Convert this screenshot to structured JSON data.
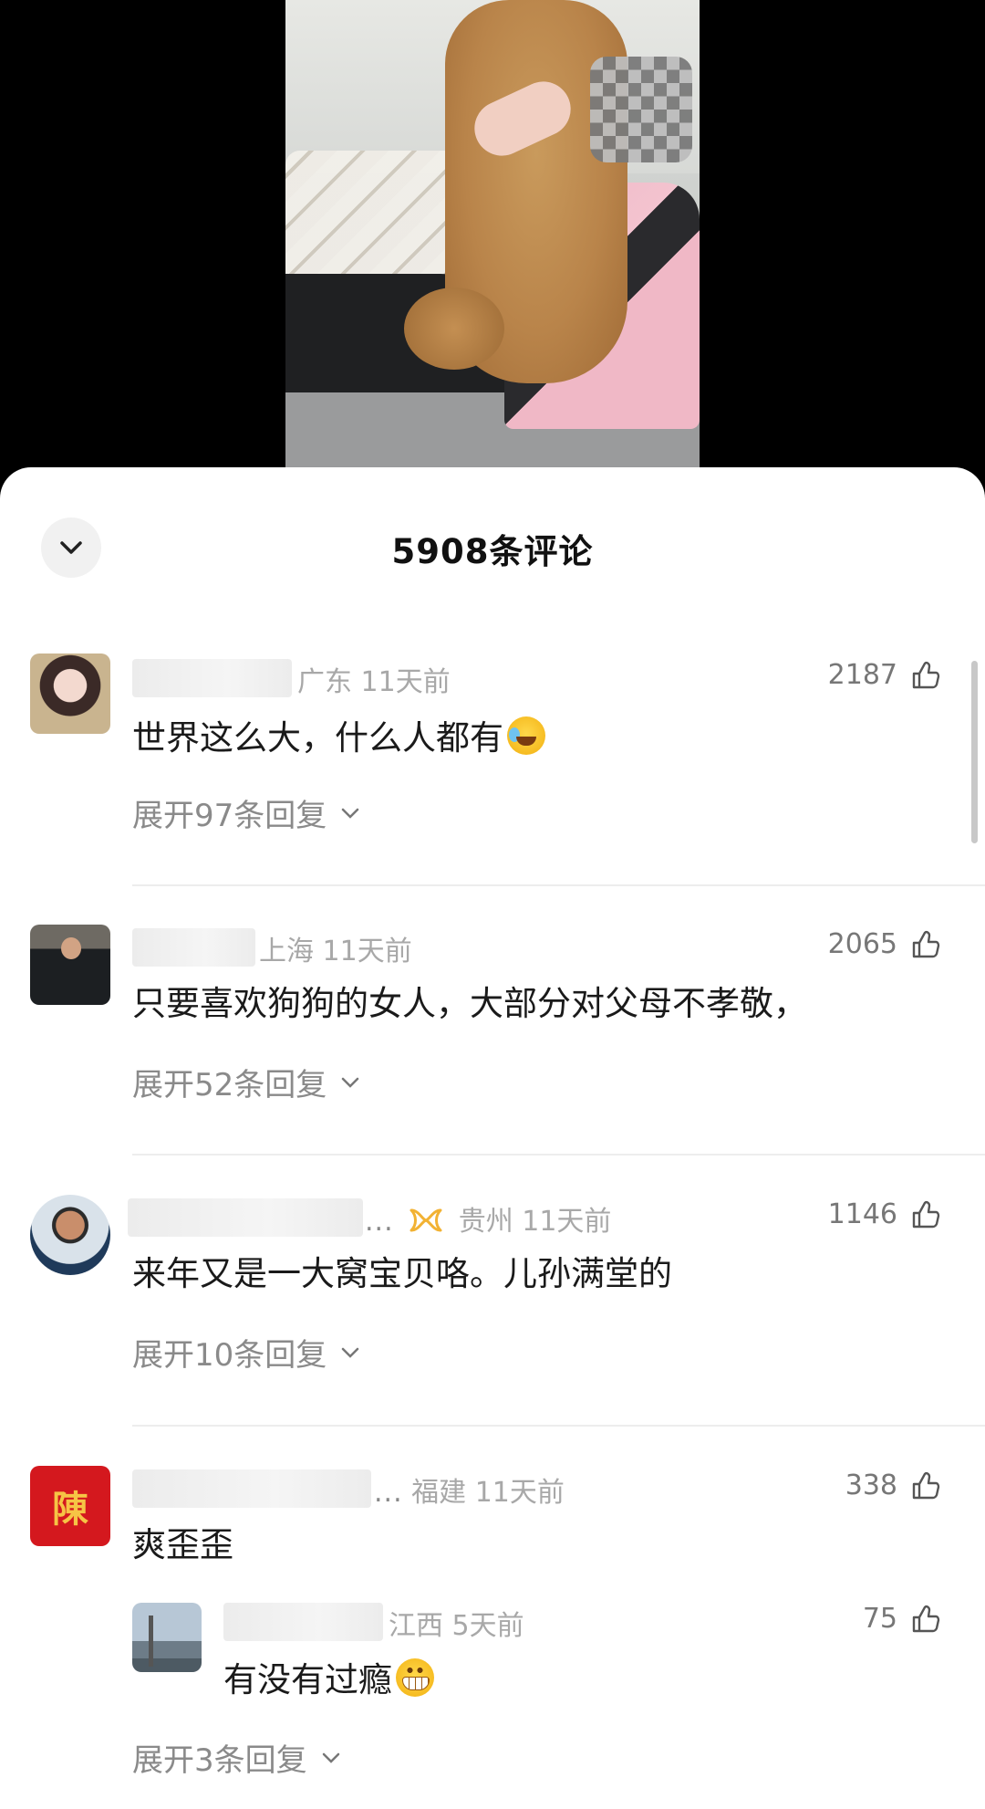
{
  "sheet": {
    "title": "5908条评论"
  },
  "comments": [
    {
      "location": "广东",
      "time": "11天前",
      "likes": "2187",
      "text": "世界这么大，什么人都有",
      "emoji": "laughing-crying-emoji",
      "expand_label": "展开97条回复"
    },
    {
      "location": "上海",
      "time": "11天前",
      "likes": "2065",
      "text": "只要喜欢狗狗的女人，大部分对父母不孝敬，",
      "expand_label": "展开52条回复"
    },
    {
      "name_suffix": "...",
      "badge_icon": "ribbon-badge-icon",
      "location": "贵州",
      "time": "11天前",
      "likes": "1146",
      "text": "来年又是一大窝宝贝咯。儿孙满堂的",
      "expand_label": "展开10条回复"
    },
    {
      "name_suffix": "...",
      "location": "福建",
      "time": "11天前",
      "likes": "338",
      "text": "爽歪歪",
      "avatar_text": "陳",
      "reply": {
        "location": "江西",
        "time": "5天前",
        "likes": "75",
        "text": "有没有过瘾",
        "emoji": "grinning-emoji"
      },
      "expand_label": "展开3条回复"
    }
  ],
  "colors": {
    "accent_badge": "#f2b233",
    "meta_gray": "#a8a8a8"
  }
}
